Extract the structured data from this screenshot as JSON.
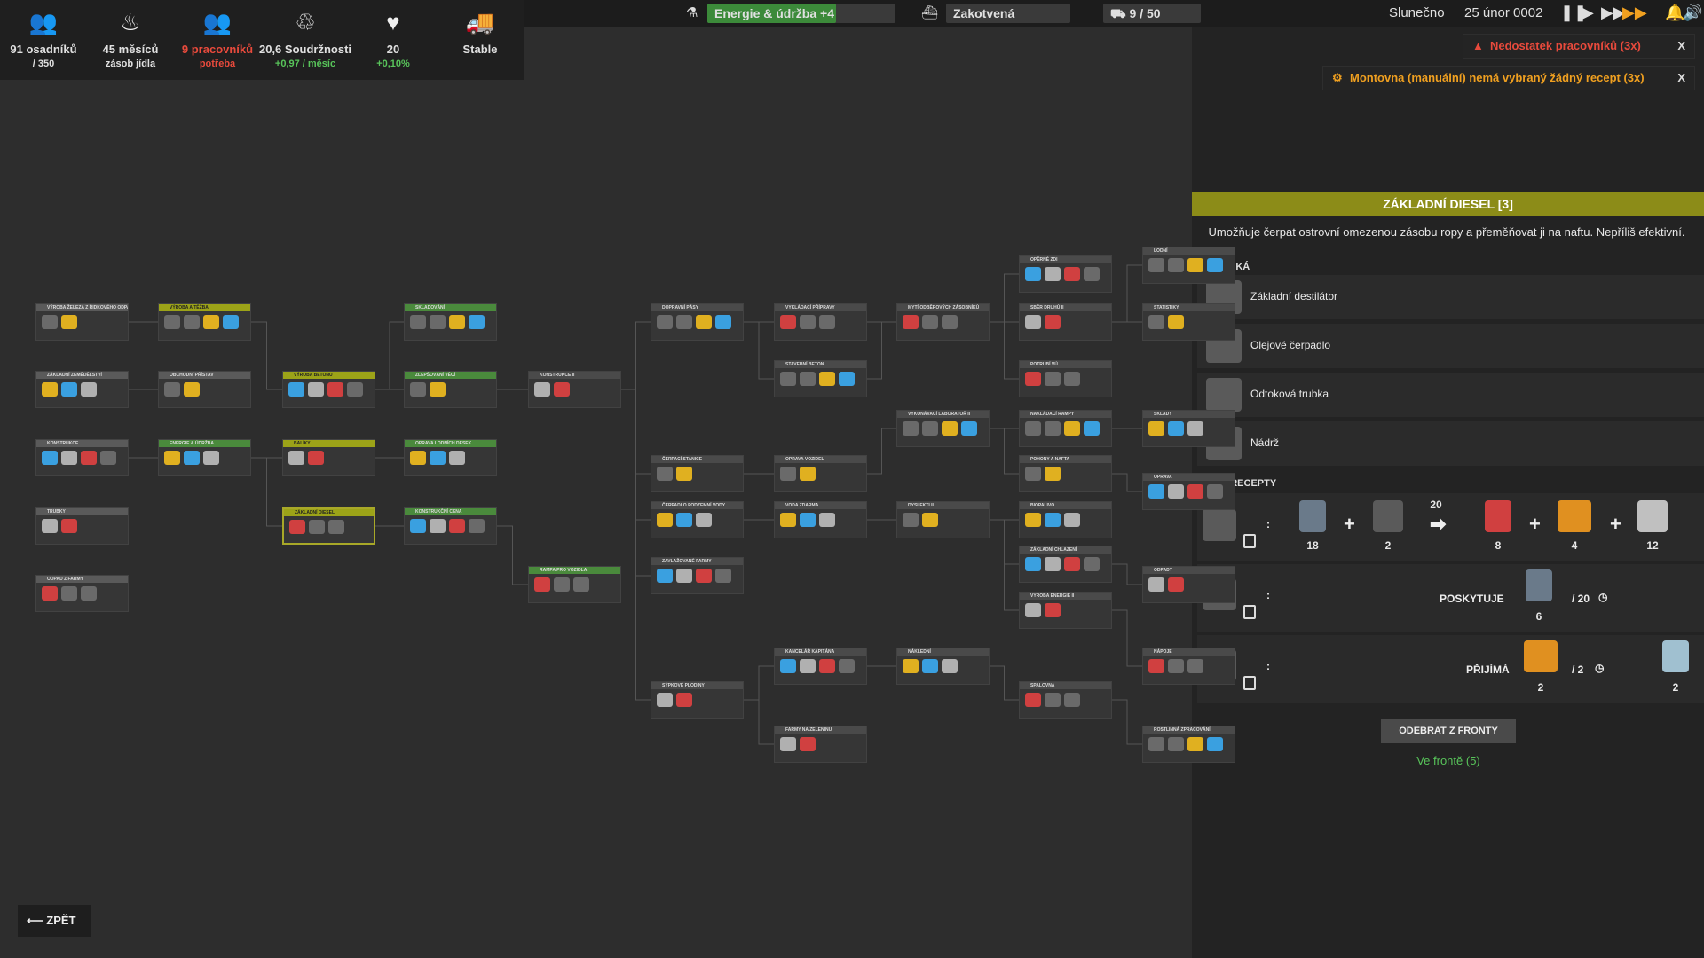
{
  "stats": [
    {
      "icon": "settlers-icon",
      "main": "91 osadníků",
      "sub": "/ 350",
      "main_color": "#ffffff",
      "sub_color": "#ffffff"
    },
    {
      "icon": "food-icon",
      "main": "45 měsíců",
      "sub": "zásob jídla",
      "main_color": "#ffffff",
      "sub_color": "#ffffff"
    },
    {
      "icon": "workers-icon",
      "main": "9 pracovníků",
      "sub": "potřeba",
      "main_color": "#e84a3c",
      "sub_color": "#e84a3c"
    },
    {
      "icon": "unity-icon",
      "main": "20,6 Soudržnosti",
      "sub": "+0,97 / měsíc",
      "main_color": "#ffffff",
      "sub_color": "#58c45a"
    },
    {
      "icon": "health-icon",
      "main": "20",
      "sub": "+0,10%",
      "main_color": "#ffffff",
      "sub_color": "#58c45a"
    },
    {
      "icon": "truck-icon",
      "main": "Stable",
      "sub": "",
      "main_color": "#ffffff",
      "sub_color": "#ffffff"
    }
  ],
  "topbar": {
    "research": "Energie & údržba +4",
    "research_progress": 0.68,
    "ship_status": "Zakotvená",
    "trucks": "9 / 50",
    "weather": "Slunečno",
    "date": "25 únor 0002"
  },
  "notifications": [
    {
      "text": "Nedostatek pracovníků (3x)",
      "color": "#e84a3c",
      "close": "X"
    },
    {
      "text": "Montovna (manuální) nemá vybraný žádný recept (3x)",
      "color": "#f0a020",
      "close": "X"
    }
  ],
  "tree_nodes": [
    {
      "label": "VÝROBA ŽELEZA Z ŘIDKOVÉHO ODPADU",
      "state": "done"
    },
    {
      "label": "ZÁKLADNÍ ZEMĚDĚLSTVÍ",
      "state": "done"
    },
    {
      "label": "KONSTRUKCE",
      "state": "done"
    },
    {
      "label": "TRUBKY",
      "state": "done"
    },
    {
      "label": "ODPAD Z FARMY",
      "state": "done"
    },
    {
      "label": "VÝROBA A TĚŽBA",
      "state": "avail"
    },
    {
      "label": "OBCHODNÍ PŘÍSTAV",
      "state": "done"
    },
    {
      "label": "ENERGIE & ÚDRŽBA",
      "state": "green"
    },
    {
      "label": "VÝROBA BETONU",
      "state": "avail"
    },
    {
      "label": "BALÍKY",
      "state": "avail"
    },
    {
      "label": "ZÁKLADNÍ DIESEL",
      "state": "avail"
    },
    {
      "label": "SKLADOVÁNÍ",
      "state": "green"
    },
    {
      "label": "ZLEPŠOVÁNÍ VĚCÍ",
      "state": "green"
    },
    {
      "label": "OPRAVA LODNÍCH DESEK",
      "state": "green"
    },
    {
      "label": "KONSTRUKČNÍ CENA",
      "state": "green"
    },
    {
      "label": "KONSTRUKCE II",
      "state": "locked"
    },
    {
      "label": "RAMPA PRO VOZIDLA",
      "state": "green"
    },
    {
      "label": "DOPRAVNÍ PÁSY",
      "state": "locked"
    },
    {
      "label": "ČERPACÍ STANICE",
      "state": "locked"
    },
    {
      "label": "ČERPADLO PODZEMNÍ VODY",
      "state": "locked"
    },
    {
      "label": "ZAVLAŽOVANÉ FARMY",
      "state": "locked"
    },
    {
      "label": "SÝPKOVÉ PLODINY",
      "state": "locked"
    },
    {
      "label": "VYKLÁDACÍ PŘÍPRAVY",
      "state": "locked"
    },
    {
      "label": "STAVEBNÍ BETON",
      "state": "locked"
    },
    {
      "label": "OPRAVA VOZIDEL",
      "state": "locked"
    },
    {
      "label": "VODA ZDARMA",
      "state": "locked"
    },
    {
      "label": "KANCELÁŘ KAPITÁNA",
      "state": "locked"
    },
    {
      "label": "FARMY NA ZELENINU",
      "state": "locked"
    },
    {
      "label": "MYTÍ ODBĚROVÝCH ZÁSOBNÍKŮ",
      "state": "locked"
    },
    {
      "label": "VYKONÁVACÍ LABORATOŘ II",
      "state": "locked"
    },
    {
      "label": "DYSLEKTI II",
      "state": "locked"
    },
    {
      "label": "NÁKLEDNÍ",
      "state": "locked"
    },
    {
      "label": "OPĚRNÉ ZDI",
      "state": "locked"
    },
    {
      "label": "SBĚR DRUHŮ II",
      "state": "locked"
    },
    {
      "label": "POTRUBÍ VÚ",
      "state": "locked"
    },
    {
      "label": "NAKLÁDACÍ RAMPY",
      "state": "locked"
    },
    {
      "label": "POHONY A NAFTA",
      "state": "locked"
    },
    {
      "label": "BIOPALIVO",
      "state": "locked"
    },
    {
      "label": "ZÁKLADNÍ CHLAZENÍ",
      "state": "locked"
    },
    {
      "label": "VÝROBA ENERGIE II",
      "state": "locked"
    },
    {
      "label": "SPALOVNA",
      "state": "locked"
    },
    {
      "label": "LODNÍ",
      "state": "locked"
    },
    {
      "label": "STATISTIKY",
      "state": "locked"
    },
    {
      "label": "SKLADY",
      "state": "locked"
    },
    {
      "label": "OPRAVA",
      "state": "locked"
    },
    {
      "label": "ODPADY",
      "state": "locked"
    },
    {
      "label": "NÁPOJE",
      "state": "locked"
    },
    {
      "label": "ROSTLINNÁ ZPRACOVÁNÍ",
      "state": "locked"
    }
  ],
  "back_label": "ZPĚT",
  "panel": {
    "title": "ZÁKLADNÍ DIESEL [3]",
    "description": "Umožňuje čerpat ostrovní omezenou zásobu ropy a přeměňovat ji na naftu. Nepříliš efektivní.",
    "unlocks_heading": "ODEMYKÁ",
    "unlocks": [
      "Základní destilátor",
      "Olejové čerpadlo",
      "Odtoková trubka",
      "Nádrž"
    ],
    "recipes_heading": "NOVÉ RECEPTY",
    "recipe1": {
      "in1": "18",
      "in2": "2",
      "time": "20",
      "out1": "8",
      "out2": "4",
      "out3": "12"
    },
    "recipe2": {
      "label": "POSKYTUJE",
      "amount": "6",
      "time": "/ 20"
    },
    "recipe3": {
      "label": "PŘIJÍMÁ",
      "amount": "2",
      "time": "/ 2",
      "extra": "2"
    },
    "colon": ":",
    "remove_button": "ODEBRAT Z FRONTY",
    "queue_status": "Ve frontě (5)"
  }
}
